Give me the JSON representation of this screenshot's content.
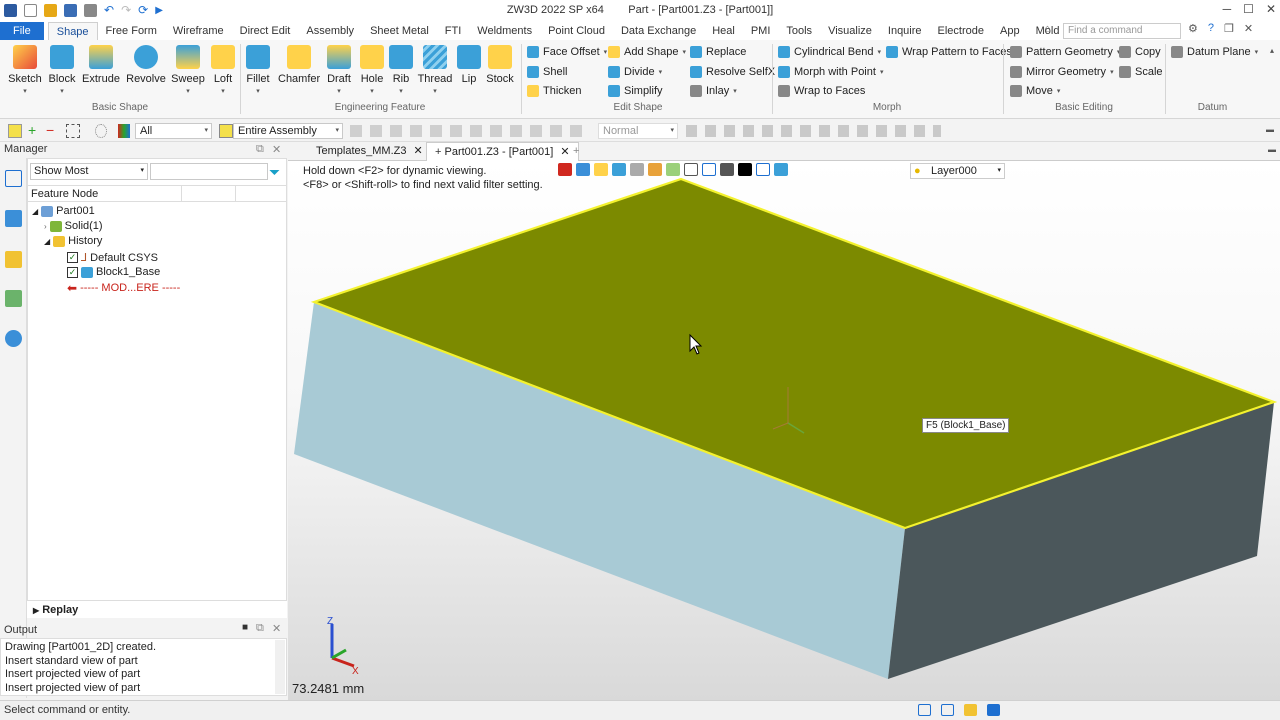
{
  "window": {
    "title": "ZW3D 2022 SP x64        Part - [Part001.Z3 - [Part001]]"
  },
  "menu_tabs": [
    "File",
    "Shape",
    "Free Form",
    "Wireframe",
    "Direct Edit",
    "Assembly",
    "Sheet Metal",
    "FTI",
    "Weldments",
    "Point Cloud",
    "Data Exchange",
    "Heal",
    "PMI",
    "Tools",
    "Visualize",
    "Inquire",
    "Electrode",
    "App",
    "Mold"
  ],
  "active_tab": "Shape",
  "find_placeholder": "Find a command",
  "ribbon": {
    "basic_shape": {
      "label": "Basic Shape",
      "items": [
        "Sketch",
        "Block",
        "Extrude",
        "Revolve",
        "Sweep",
        "Loft"
      ]
    },
    "engineering_feature": {
      "label": "Engineering Feature",
      "items": [
        "Fillet",
        "Chamfer",
        "Draft",
        "Hole",
        "Rib",
        "Thread",
        "Lip",
        "Stock"
      ]
    },
    "edit_shape": {
      "label": "Edit Shape",
      "col1": [
        "Face Offset",
        "Shell",
        "Thicken"
      ],
      "col2": [
        "Add Shape",
        "Divide",
        "Simplify"
      ],
      "col3": [
        "Replace",
        "Resolve SelfX",
        "Inlay"
      ]
    },
    "morph": {
      "label": "Morph",
      "col1": [
        "Cylindrical Bend",
        "Morph with Point",
        "Wrap to Faces"
      ],
      "col2": [
        "Wrap Pattern to Faces"
      ]
    },
    "basic_editing": {
      "label": "Basic Editing",
      "col1": [
        "Pattern Geometry",
        "Mirror Geometry",
        "Move"
      ],
      "col2": [
        "Copy",
        "Scale"
      ]
    },
    "datum": {
      "label": "Datum",
      "items": [
        "Datum Plane"
      ]
    }
  },
  "toolbar2": {
    "filter": "All",
    "scope": "Entire Assembly",
    "mode": "Normal"
  },
  "manager": {
    "title": "Manager",
    "show_most": "Show Most",
    "column": "Feature Node",
    "tree": [
      {
        "label": "Part001",
        "level": 0
      },
      {
        "label": "Solid(1)",
        "level": 1
      },
      {
        "label": "History",
        "level": 1
      },
      {
        "label": "Default CSYS",
        "level": 2
      },
      {
        "label": "Block1_Base",
        "level": 2
      },
      {
        "label": "----- MOD...ERE -----",
        "level": 2
      }
    ],
    "replay": "Replay"
  },
  "output": {
    "title": "Output",
    "lines": [
      "Drawing [Part001_2D] created.",
      "Insert standard view of part",
      "Insert projected view of part",
      "Insert projected view of part"
    ]
  },
  "doc_tabs": [
    "Templates_MM.Z3",
    "Part001.Z3 - [Part001]"
  ],
  "viewport": {
    "hint": "Hold down <F2> for dynamic viewing.\n<F8> or <Shift-roll> to find next valid filter setting.",
    "layer": "Layer000",
    "tooltip": "F5 (Block1_Base)",
    "measure": "73.2481 mm",
    "colors": {
      "top": "#7c8a00",
      "front": "#a8cad5",
      "right": "#4b575b",
      "highlight": "#f4f22e"
    }
  },
  "status": "Select command or entity."
}
